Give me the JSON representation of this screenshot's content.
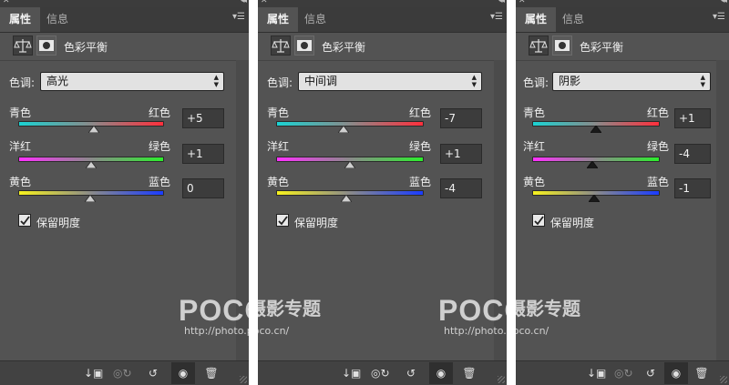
{
  "tabs": {
    "properties": "属性",
    "info": "信息"
  },
  "adjustment_title": "色彩平衡",
  "tone_label": "色调:",
  "slider_labels": {
    "cyan": "青色",
    "red": "红色",
    "magenta": "洋红",
    "green": "绿色",
    "yellow": "黄色",
    "blue": "蓝色"
  },
  "preserve_luminosity": "保留明度",
  "icons": {
    "adjust": "scales-icon",
    "mask": "mask-icon",
    "clip": "clip-to-layer-icon",
    "view_previous": "view-previous-icon",
    "reset": "reset-icon",
    "visibility": "eye-icon",
    "delete": "trash-icon"
  },
  "panels": [
    {
      "tone": "高光",
      "cyan_red": "+5",
      "magenta_green": "+1",
      "yellow_blue": "0",
      "cyan_red_value": 5,
      "magenta_green_value": 1,
      "yellow_blue_value": 0
    },
    {
      "tone": "中间调",
      "cyan_red": "-7",
      "magenta_green": "+1",
      "yellow_blue": "-4",
      "cyan_red_value": -7,
      "magenta_green_value": 1,
      "yellow_blue_value": -4
    },
    {
      "tone": "阴影",
      "cyan_red": "+1",
      "magenta_green": "-4",
      "yellow_blue": "-1",
      "cyan_red_value": 1,
      "magenta_green_value": -4,
      "yellow_blue_value": -1
    }
  ],
  "watermark": {
    "brand": "POCO",
    "cn": "摄影专题",
    "url": "http://photo.poco.cn/"
  }
}
